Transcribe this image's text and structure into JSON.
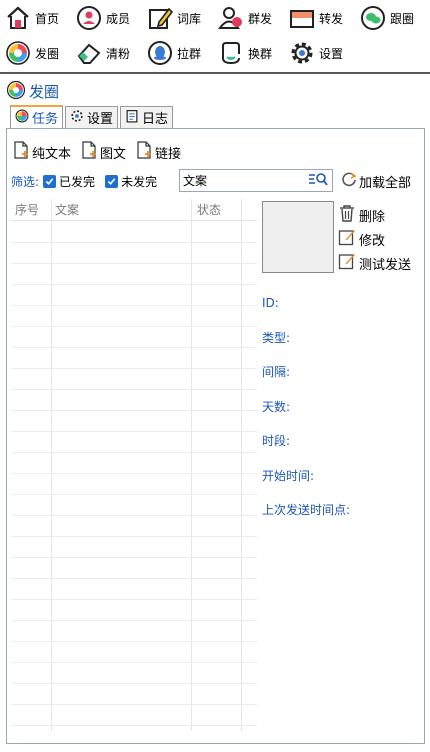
{
  "toolbar": {
    "row1": [
      {
        "label": "首页",
        "icon": "home-icon"
      },
      {
        "label": "成员",
        "icon": "member-icon"
      },
      {
        "label": "词库",
        "icon": "edit-icon"
      },
      {
        "label": "群发",
        "icon": "group-send-icon"
      },
      {
        "label": "转发",
        "icon": "forward-icon"
      },
      {
        "label": "跟圈",
        "icon": "wechat-icon"
      }
    ],
    "row2": [
      {
        "label": "发圈",
        "icon": "moments-icon"
      },
      {
        "label": "清粉",
        "icon": "eraser-icon"
      },
      {
        "label": "拉群",
        "icon": "qq-icon"
      },
      {
        "label": "换群",
        "icon": "switch-group-icon"
      },
      {
        "label": "设置",
        "icon": "gear-icon"
      }
    ]
  },
  "section": {
    "title": "发圈"
  },
  "tabs": [
    {
      "label": "任务",
      "active": true
    },
    {
      "label": "设置",
      "active": false
    },
    {
      "label": "日志",
      "active": false
    }
  ],
  "add_buttons": [
    "纯文本",
    "图文",
    "链接"
  ],
  "filter": {
    "label": "筛选:",
    "sent_label": "已发完",
    "unsent_label": "未发完",
    "search_value": "文案",
    "reload_label": "加载全部"
  },
  "table": {
    "headers": [
      "序号",
      "文案",
      "状态"
    ],
    "rows": []
  },
  "actions": {
    "delete": "删除",
    "edit": "修改",
    "test_send": "测试发送"
  },
  "info_labels": [
    "ID:",
    "类型:",
    "间隔:",
    "天数:",
    "时段:",
    "开始时间:",
    "上次发送时间点:"
  ],
  "colors": {
    "accent": "#1a56b8",
    "checkbox": "#1f6fd1",
    "tab_active": "#f2a33c"
  }
}
